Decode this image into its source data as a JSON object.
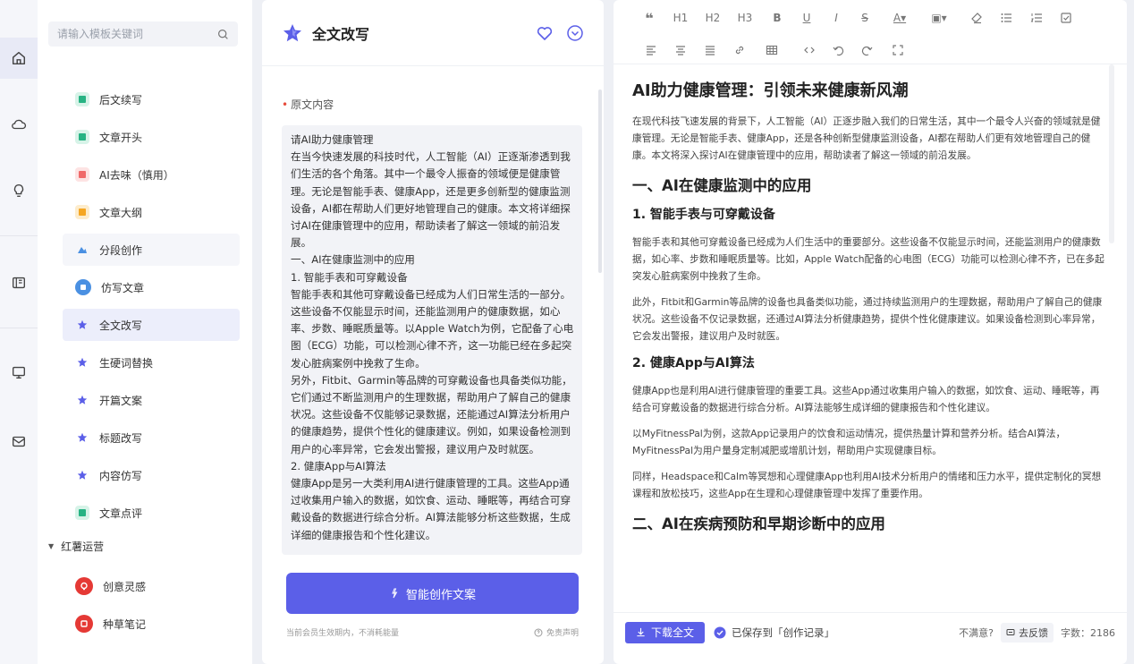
{
  "rail": {
    "icons": [
      "home-icon",
      "cloud-icon",
      "bulb-icon",
      "book-icon",
      "monitor-icon",
      "mail-icon"
    ]
  },
  "templates": {
    "search_placeholder": "请输入模板关键词",
    "items": [
      {
        "label": "后文续写",
        "color": "#27b383"
      },
      {
        "label": "文章开头",
        "color": "#27b383"
      },
      {
        "label": "AI去味（慎用）",
        "color": "#f06a6a"
      },
      {
        "label": "文章大纲",
        "color": "#f5a623"
      },
      {
        "label": "分段创作",
        "color": "#4a90e2"
      },
      {
        "label": "仿写文章",
        "color": "#4a90e2"
      },
      {
        "label": "全文改写",
        "color": "#5b5fe8"
      },
      {
        "label": "生硬词替换",
        "color": "#5b5fe8"
      },
      {
        "label": "开篇文案",
        "color": "#5b5fe8"
      },
      {
        "label": "标题改写",
        "color": "#5b5fe8"
      },
      {
        "label": "内容仿写",
        "color": "#5b5fe8"
      },
      {
        "label": "文章点评",
        "color": "#27b383"
      }
    ],
    "group_label": "红薯运营",
    "group_items": [
      {
        "label": "创意灵感",
        "color": "#e53935"
      },
      {
        "label": "种草笔记",
        "color": "#e53935"
      }
    ]
  },
  "form": {
    "title": "全文改写",
    "field_label": "原文内容",
    "source_text": [
      "请AI助力健康管理",
      "在当今快速发展的科技时代，人工智能（AI）正逐渐渗透到我们生活的各个角落。其中一个最令人振奋的领域便是健康管理。无论是智能手表、健康App，还是更多创新型的健康监测设备，AI都在帮助人们更好地管理自己的健康。本文将详细探讨AI在健康管理中的应用，帮助读者了解这一领域的前沿发展。",
      "一、AI在健康监测中的应用",
      "1. 智能手表和可穿戴设备",
      "智能手表和其他可穿戴设备已经成为人们日常生活的一部分。这些设备不仅能显示时间，还能监测用户的健康数据，如心率、步数、睡眠质量等。以Apple Watch为例，它配备了心电图（ECG）功能，可以检测心律不齐，这一功能已经在多起突发心脏病案例中挽救了生命。",
      "另外，Fitbit、Garmin等品牌的可穿戴设备也具备类似功能，它们通过不断监测用户的生理数据，帮助用户了解自己的健康状况。这些设备不仅能够记录数据，还能通过AI算法分析用户的健康趋势，提供个性化的健康建议。例如，如果设备检测到用户的心率异常，它会发出警报，建议用户及时就医。",
      "2. 健康App与AI算法",
      "健康App是另一大类利用AI进行健康管理的工具。这些App通过收集用户输入的数据，如饮食、运动、睡眠等，再结合可穿戴设备的数据进行综合分析。AI算法能够分析这些数据，生成详细的健康报告和个性化建议。"
    ],
    "generate_label": "智能创作文案",
    "footer_note": "当前会员生效期内，不消耗能量",
    "disclaimer": "免责声明"
  },
  "editor": {
    "toolbar_row1": [
      "❝",
      "H1",
      "H2",
      "H3",
      "B",
      "U",
      "I",
      "S",
      "A▾",
      "▣▾",
      "eraser",
      "ul",
      "ol",
      "check"
    ],
    "toolbar_row2": [
      "align-left",
      "align-center",
      "align-justify",
      "link",
      "table",
      "code",
      "undo",
      "redo",
      "fullscreen"
    ],
    "doc": {
      "title": "AI助力健康管理：引领未来健康新风潮",
      "intro": "在现代科技飞速发展的背景下，人工智能（AI）正逐步融入我们的日常生活，其中一个最令人兴奋的领域就是健康管理。无论是智能手表、健康App，还是各种创新型健康监测设备，AI都在帮助人们更有效地管理自己的健康。本文将深入探讨AI在健康管理中的应用，帮助读者了解这一领域的前沿发展。",
      "h2_1": "一、AI在健康监测中的应用",
      "h3_1": "1. 智能手表与可穿戴设备",
      "p1": "智能手表和其他可穿戴设备已经成为人们生活中的重要部分。这些设备不仅能显示时间，还能监测用户的健康数据，如心率、步数和睡眠质量等。比如，Apple Watch配备的心电图（ECG）功能可以检测心律不齐，已在多起突发心脏病案例中挽救了生命。",
      "p2": "此外，Fitbit和Garmin等品牌的设备也具备类似功能，通过持续监测用户的生理数据，帮助用户了解自己的健康状况。这些设备不仅记录数据，还通过AI算法分析健康趋势，提供个性化健康建议。如果设备检测到心率异常，它会发出警报，建议用户及时就医。",
      "h3_2": "2. 健康App与AI算法",
      "p3": "健康App也是利用AI进行健康管理的重要工具。这些App通过收集用户输入的数据，如饮食、运动、睡眠等，再结合可穿戴设备的数据进行综合分析。AI算法能够生成详细的健康报告和个性化建议。",
      "p4": "以MyFitnessPal为例，这款App记录用户的饮食和运动情况，提供热量计算和营养分析。结合AI算法，MyFitnessPal为用户量身定制减肥或增肌计划，帮助用户实现健康目标。",
      "p5": "同样，Headspace和Calm等冥想和心理健康App也利用AI技术分析用户的情绪和压力水平，提供定制化的冥想课程和放松技巧，这些App在生理和心理健康管理中发挥了重要作用。",
      "h2_2": "二、AI在疾病预防和早期诊断中的应用"
    },
    "download_label": "下载全文",
    "saved_label": "已保存到「创作记录」",
    "unsatisfied": "不满意?",
    "feedback_label": "去反馈",
    "word_count": "字数：2186"
  }
}
